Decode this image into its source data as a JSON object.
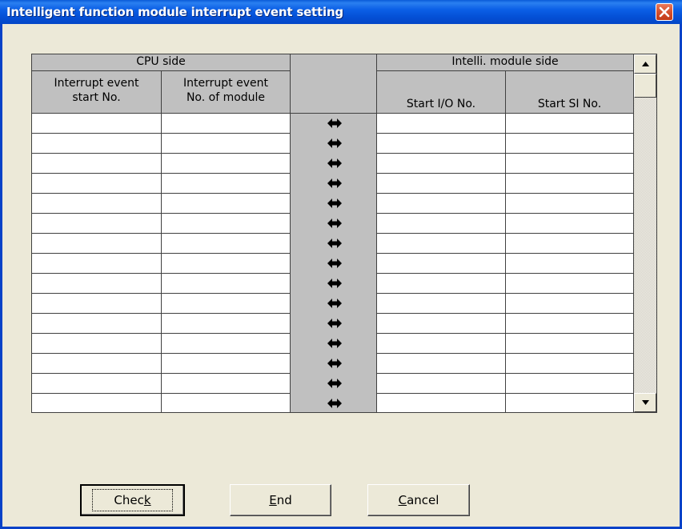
{
  "window": {
    "title": "Intelligent function module interrupt event setting"
  },
  "grid": {
    "group_cpu": "CPU side",
    "group_module": "Intelli. module side",
    "col_interrupt_start_line1": "Interrupt event",
    "col_interrupt_start_line2": "start No.",
    "col_interrupt_count_line1": "Interrupt event",
    "col_interrupt_count_line2": "No. of module",
    "col_start_io": "Start I/O No.",
    "col_start_si": "Start SI No.",
    "row_count": 15,
    "link_icon": "double-arrow-icon"
  },
  "buttons": {
    "check": {
      "before": "Chec",
      "mnemonic": "k",
      "after": ""
    },
    "end": {
      "before": "",
      "mnemonic": "E",
      "after": "nd"
    },
    "cancel": {
      "before": "",
      "mnemonic": "C",
      "after": "ancel"
    }
  },
  "colors": {
    "titlebar": "#0b5fe6",
    "dialog": "#ece9d8",
    "header": "#c0c0c0",
    "close": "#d4502e"
  }
}
